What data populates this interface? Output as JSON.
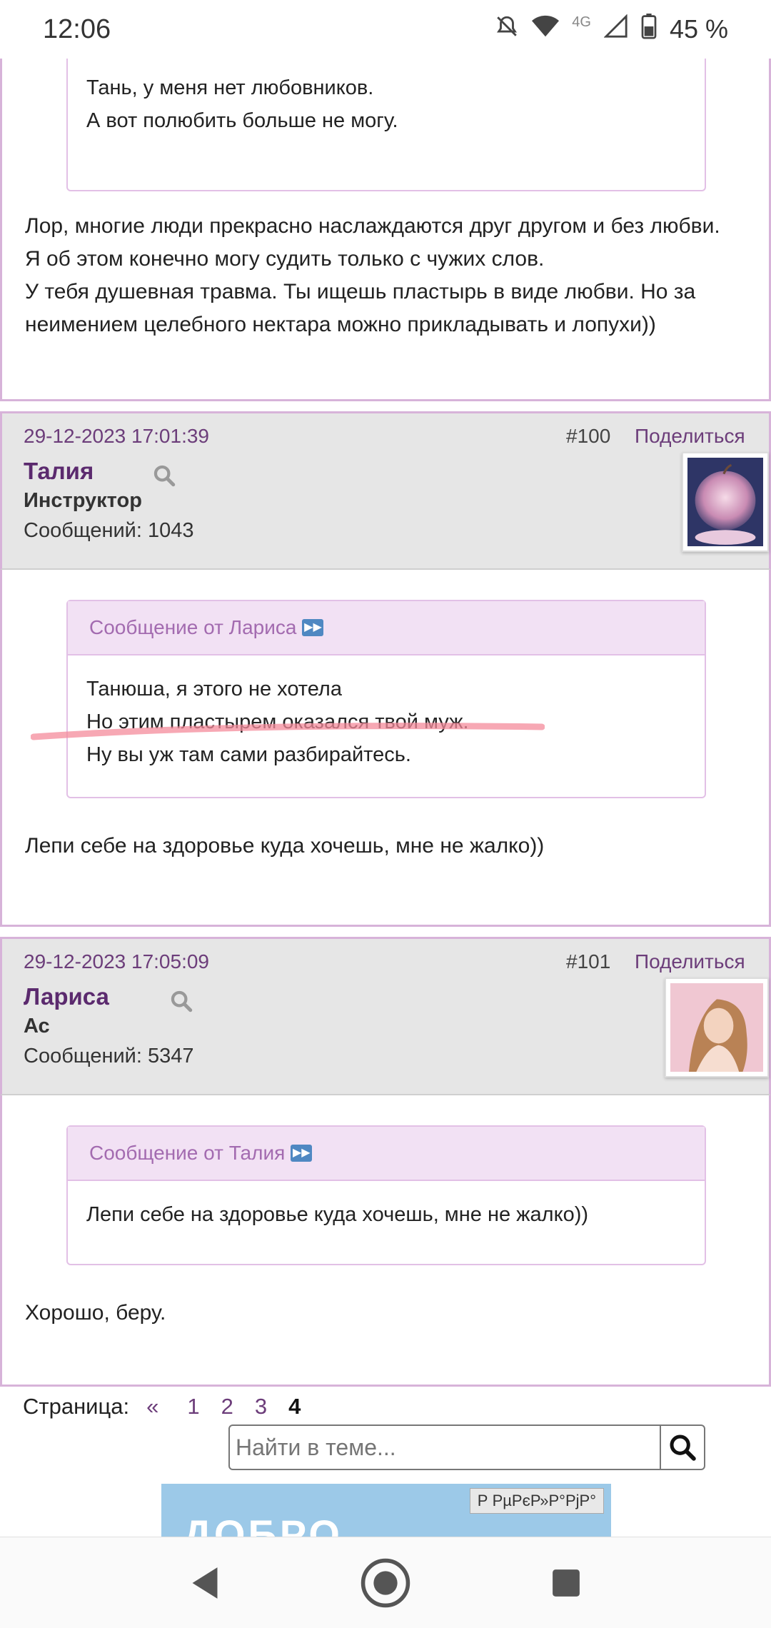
{
  "status_bar": {
    "time": "12:06",
    "network": "4G",
    "battery": "45 %"
  },
  "post_top": {
    "quote_lines": [
      "Тань, у меня нет любовников.",
      "А вот полюбить больше не могу."
    ],
    "text_lines": [
      "Лор, многие люди прекрасно наслаждаются друг другом и без любви.",
      "Я об этом конечно могу судить только с чужих слов.",
      "У тебя душевная травма. Ты ищешь пластырь в виде любви. Но за",
      "неимением целебного нектара можно прикладывать и лопухи))"
    ]
  },
  "post_100": {
    "date": "29-12-2023 17:01:39",
    "number": "#100",
    "share": "Поделиться",
    "author": "Талия",
    "rank": "Инструктор",
    "messages": "Сообщений: 1043",
    "quote_head": "Сообщение от Лариса",
    "quote_lines": [
      "Танюша, я этого не хотела",
      "Но этим пластырем оказался твой муж.",
      "Ну вы уж там сами разбирайтесь."
    ],
    "text": "Лепи себе на здоровье куда хочешь, мне не жалко))"
  },
  "post_101": {
    "date": "29-12-2023 17:05:09",
    "number": "#101",
    "share": "Поделиться",
    "author": "Лариса",
    "rank": "Ас",
    "messages": "Сообщений: 5347",
    "quote_head": "Сообщение от Талия",
    "quote_lines": [
      "Лепи себе на здоровье куда хочешь, мне не жалко))"
    ],
    "text": "Хорошо, беру."
  },
  "pager": {
    "label": "Страница:",
    "prev": "«",
    "pages": [
      "1",
      "2",
      "3",
      "4"
    ]
  },
  "search": {
    "placeholder": "Найти в теме..."
  },
  "banner": {
    "text": "ДОБРО ПОЖАЛОВАТЬ",
    "ad_label": "Р РµРєР»Р°РјР°"
  },
  "colors": {
    "accent": "#6c3d7a",
    "quote_head_bg": "#f2e1f4",
    "border": "#d7b3d9"
  }
}
